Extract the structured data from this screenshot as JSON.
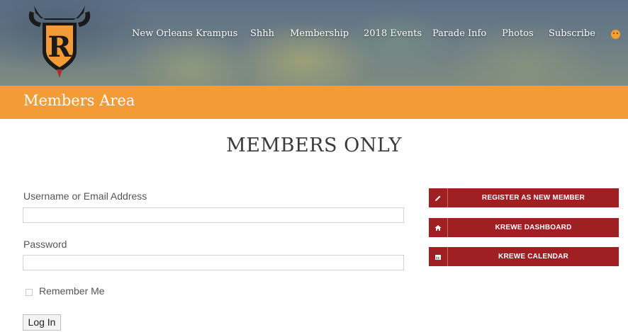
{
  "header": {
    "logo_icon": "krampus-crest-logo-icon",
    "nav": [
      {
        "label": "New Orleans Krampus"
      },
      {
        "label": "Shhh"
      },
      {
        "label": "Membership"
      },
      {
        "label": "2018 Events"
      },
      {
        "label": "Parade Info"
      },
      {
        "label": "Photos"
      },
      {
        "label": "Subscribe"
      }
    ],
    "smiley_icon": "smiley-icon"
  },
  "section_bar": {
    "title": "Members Area",
    "color": "#f29b37"
  },
  "main": {
    "title": "MEMBERS ONLY",
    "form": {
      "username_label": "Username or Email Address",
      "username_value": "",
      "password_label": "Password",
      "password_value": "",
      "remember_label": "Remember Me",
      "remember_checked": false,
      "submit_label": "Log In"
    }
  },
  "sidebar": {
    "accent": "#a01f23",
    "buttons": [
      {
        "label": "REGISTER AS NEW MEMBER",
        "icon": "pencil-icon"
      },
      {
        "label": "KREWE DASHBOARD",
        "icon": "home-icon"
      },
      {
        "label": "KREWE CALENDAR",
        "icon": "calendar-icon"
      }
    ]
  }
}
